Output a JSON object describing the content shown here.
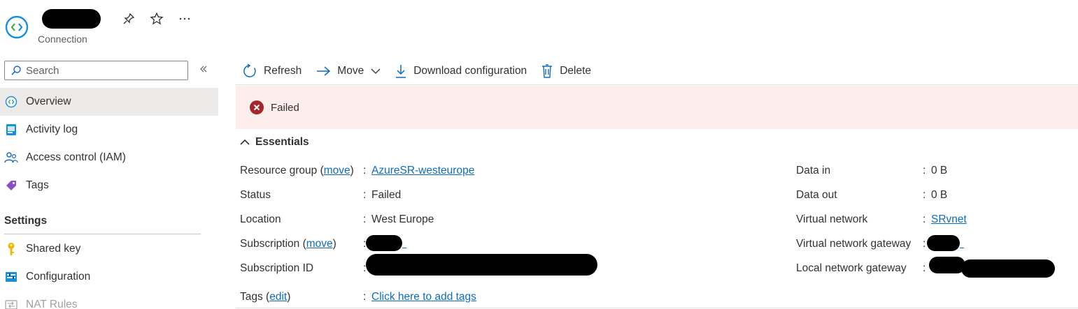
{
  "header": {
    "subtitle": "Connection",
    "icons": [
      "pin-icon",
      "star-icon",
      "more-icon"
    ]
  },
  "sidebar": {
    "search_placeholder": "Search",
    "items": [
      {
        "label": "Overview",
        "icon": "connection-icon",
        "active": true
      },
      {
        "label": "Activity log",
        "icon": "activity-log-icon"
      },
      {
        "label": "Access control (IAM)",
        "icon": "iam-icon"
      },
      {
        "label": "Tags",
        "icon": "tag-icon"
      }
    ],
    "settings_title": "Settings",
    "settings_items": [
      {
        "label": "Shared key",
        "icon": "key-icon"
      },
      {
        "label": "Configuration",
        "icon": "configuration-icon"
      },
      {
        "label": "NAT Rules",
        "icon": "nat-rules-icon"
      }
    ]
  },
  "toolbar": {
    "refresh": "Refresh",
    "move": "Move",
    "download": "Download configuration",
    "delete": "Delete"
  },
  "banner": {
    "status": "Failed",
    "color": "#a4262c",
    "background": "#fdeded"
  },
  "essentials": {
    "title": "Essentials",
    "left": {
      "resource_group_label": "Resource group",
      "move_link": "move",
      "resource_group_value": "AzureSR-westeurope",
      "status_label": "Status",
      "status_value": "Failed",
      "location_label": "Location",
      "location_value": "West Europe",
      "subscription_label": "Subscription",
      "subscription_id_label": "Subscription ID",
      "tags_label": "Tags",
      "edit_link": "edit",
      "tags_value": "Click here to add tags"
    },
    "right": {
      "data_in_label": "Data in",
      "data_in_value": "0 B",
      "data_out_label": "Data out",
      "data_out_value": "0 B",
      "vnet_label": "Virtual network",
      "vnet_value": "SRvnet",
      "vng_label": "Virtual network gateway",
      "lng_label": "Local network gateway"
    }
  },
  "colors": {
    "accent": "#0f6cbd",
    "active_nav": "#edebe9"
  }
}
